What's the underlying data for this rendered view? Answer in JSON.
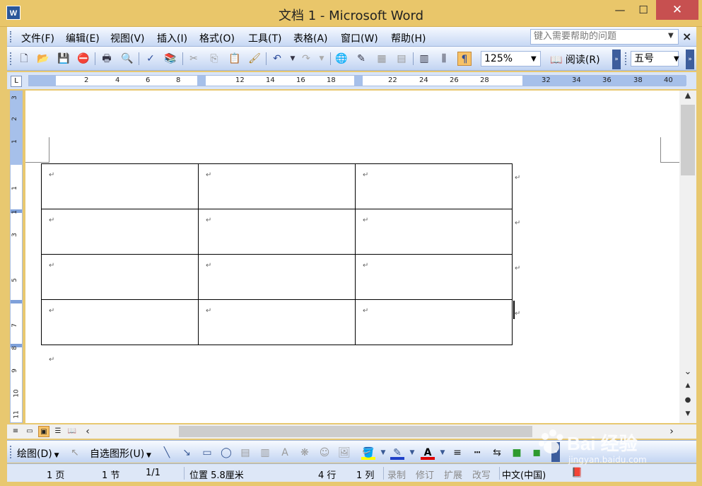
{
  "window": {
    "title": "文档 1 - Microsoft Word",
    "app_icon": "W",
    "controls": {
      "minimize": "—",
      "maximize": "☐",
      "close": "✕"
    }
  },
  "menu": {
    "items": [
      "文件(F)",
      "编辑(E)",
      "视图(V)",
      "插入(I)",
      "格式(O)",
      "工具(T)",
      "表格(A)",
      "窗口(W)",
      "帮助(H)"
    ],
    "help_placeholder": "键入需要帮助的问题",
    "close_glyph": "×"
  },
  "toolbar": {
    "zoom": "125%",
    "read_label": "阅读(R)",
    "font_size": "五号"
  },
  "ruler": {
    "h_numbers": [
      "2",
      "4",
      "6",
      "8",
      "12",
      "14",
      "16",
      "18",
      "22",
      "24",
      "26",
      "28",
      "32",
      "34",
      "36",
      "38",
      "40"
    ],
    "v_numbers": [
      "3",
      "2",
      "1",
      "1",
      "1",
      "3",
      "5",
      "7",
      "8",
      "9",
      "10",
      "11"
    ]
  },
  "document": {
    "rows": 4,
    "cols": 3,
    "cell_mark": "↵"
  },
  "drawbar": {
    "draw_label": "绘图(D)",
    "autoshape_label": "自选图形(U)"
  },
  "status": {
    "page": "1 页",
    "section": "1 节",
    "pages": "1/1",
    "position": "位置 5.8厘米",
    "line": "4 行",
    "column": "1 列",
    "rec": "录制",
    "trk": "修订",
    "ext": "扩展",
    "ovr": "改写",
    "language": "中文(中国)"
  },
  "watermark": {
    "brand": "Bai 经验",
    "url": "jingyan.baidu.com"
  },
  "colors": {
    "title_bar": "#e9c66a",
    "toolbar_gradient_end": "#c2d4f2",
    "close_button": "#c75050",
    "highlight_yellow": "#ffff00",
    "font_color_red": "#e00000"
  }
}
